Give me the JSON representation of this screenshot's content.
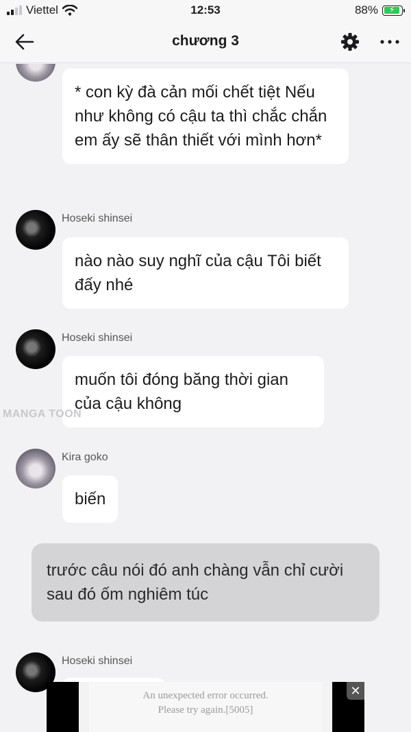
{
  "status_bar": {
    "carrier": "Viettel",
    "time": "12:53",
    "battery": "88%",
    "battery_level": 0.88
  },
  "header": {
    "title": "chương 3"
  },
  "messages": [
    {
      "text": "* con kỳ đà cản mối chết tiệt Nếu như không có cậu ta thì chắc chắn em ấy sẽ thân thiết với mình hơn*"
    },
    {
      "name": "Hoseki shinsei",
      "text": "nào nào suy nghĩ của cậu Tôi biết đấy nhé"
    },
    {
      "name": "Hoseki shinsei",
      "text": "muốn tôi đóng băng thời gian của cậu không"
    },
    {
      "name": "Kira goko",
      "text": "biến"
    },
    {
      "narration": "trước câu nói đó anh chàng vẫn chỉ cười sau đó ốm nghiêm túc"
    },
    {
      "name": "Hoseki shinsei"
    }
  ],
  "watermark": "MANGA TOON",
  "ad": {
    "line1": "An unexpected error occurred.",
    "line2": "Please try again.[5005]",
    "close": "✕"
  },
  "icons": [
    "back-arrow-icon",
    "gear-icon",
    "more-icon",
    "wifi-icon",
    "battery-icon"
  ]
}
